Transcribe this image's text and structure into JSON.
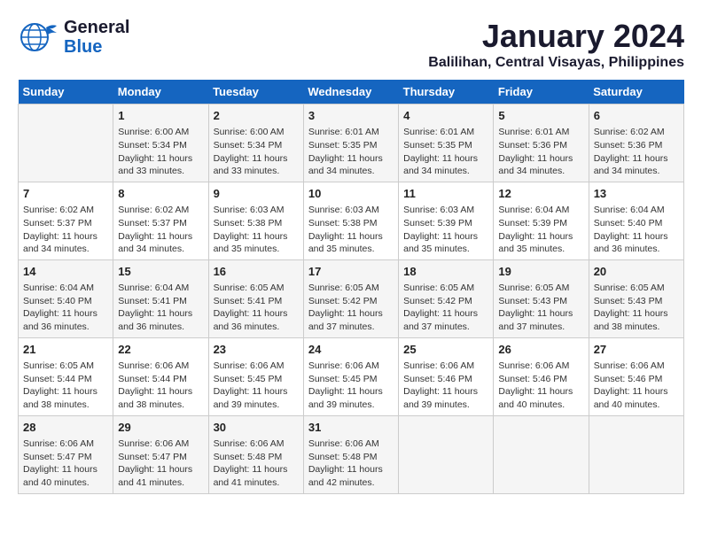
{
  "header": {
    "logo_general": "General",
    "logo_blue": "Blue",
    "month_title": "January 2024",
    "location": "Balilihan, Central Visayas, Philippines"
  },
  "days_of_week": [
    "Sunday",
    "Monday",
    "Tuesday",
    "Wednesday",
    "Thursday",
    "Friday",
    "Saturday"
  ],
  "weeks": [
    [
      {
        "day": "",
        "info": ""
      },
      {
        "day": "1",
        "info": "Sunrise: 6:00 AM\nSunset: 5:34 PM\nDaylight: 11 hours\nand 33 minutes."
      },
      {
        "day": "2",
        "info": "Sunrise: 6:00 AM\nSunset: 5:34 PM\nDaylight: 11 hours\nand 33 minutes."
      },
      {
        "day": "3",
        "info": "Sunrise: 6:01 AM\nSunset: 5:35 PM\nDaylight: 11 hours\nand 34 minutes."
      },
      {
        "day": "4",
        "info": "Sunrise: 6:01 AM\nSunset: 5:35 PM\nDaylight: 11 hours\nand 34 minutes."
      },
      {
        "day": "5",
        "info": "Sunrise: 6:01 AM\nSunset: 5:36 PM\nDaylight: 11 hours\nand 34 minutes."
      },
      {
        "day": "6",
        "info": "Sunrise: 6:02 AM\nSunset: 5:36 PM\nDaylight: 11 hours\nand 34 minutes."
      }
    ],
    [
      {
        "day": "7",
        "info": "Sunrise: 6:02 AM\nSunset: 5:37 PM\nDaylight: 11 hours\nand 34 minutes."
      },
      {
        "day": "8",
        "info": "Sunrise: 6:02 AM\nSunset: 5:37 PM\nDaylight: 11 hours\nand 34 minutes."
      },
      {
        "day": "9",
        "info": "Sunrise: 6:03 AM\nSunset: 5:38 PM\nDaylight: 11 hours\nand 35 minutes."
      },
      {
        "day": "10",
        "info": "Sunrise: 6:03 AM\nSunset: 5:38 PM\nDaylight: 11 hours\nand 35 minutes."
      },
      {
        "day": "11",
        "info": "Sunrise: 6:03 AM\nSunset: 5:39 PM\nDaylight: 11 hours\nand 35 minutes."
      },
      {
        "day": "12",
        "info": "Sunrise: 6:04 AM\nSunset: 5:39 PM\nDaylight: 11 hours\nand 35 minutes."
      },
      {
        "day": "13",
        "info": "Sunrise: 6:04 AM\nSunset: 5:40 PM\nDaylight: 11 hours\nand 36 minutes."
      }
    ],
    [
      {
        "day": "14",
        "info": "Sunrise: 6:04 AM\nSunset: 5:40 PM\nDaylight: 11 hours\nand 36 minutes."
      },
      {
        "day": "15",
        "info": "Sunrise: 6:04 AM\nSunset: 5:41 PM\nDaylight: 11 hours\nand 36 minutes."
      },
      {
        "day": "16",
        "info": "Sunrise: 6:05 AM\nSunset: 5:41 PM\nDaylight: 11 hours\nand 36 minutes."
      },
      {
        "day": "17",
        "info": "Sunrise: 6:05 AM\nSunset: 5:42 PM\nDaylight: 11 hours\nand 37 minutes."
      },
      {
        "day": "18",
        "info": "Sunrise: 6:05 AM\nSunset: 5:42 PM\nDaylight: 11 hours\nand 37 minutes."
      },
      {
        "day": "19",
        "info": "Sunrise: 6:05 AM\nSunset: 5:43 PM\nDaylight: 11 hours\nand 37 minutes."
      },
      {
        "day": "20",
        "info": "Sunrise: 6:05 AM\nSunset: 5:43 PM\nDaylight: 11 hours\nand 38 minutes."
      }
    ],
    [
      {
        "day": "21",
        "info": "Sunrise: 6:05 AM\nSunset: 5:44 PM\nDaylight: 11 hours\nand 38 minutes."
      },
      {
        "day": "22",
        "info": "Sunrise: 6:06 AM\nSunset: 5:44 PM\nDaylight: 11 hours\nand 38 minutes."
      },
      {
        "day": "23",
        "info": "Sunrise: 6:06 AM\nSunset: 5:45 PM\nDaylight: 11 hours\nand 39 minutes."
      },
      {
        "day": "24",
        "info": "Sunrise: 6:06 AM\nSunset: 5:45 PM\nDaylight: 11 hours\nand 39 minutes."
      },
      {
        "day": "25",
        "info": "Sunrise: 6:06 AM\nSunset: 5:46 PM\nDaylight: 11 hours\nand 39 minutes."
      },
      {
        "day": "26",
        "info": "Sunrise: 6:06 AM\nSunset: 5:46 PM\nDaylight: 11 hours\nand 40 minutes."
      },
      {
        "day": "27",
        "info": "Sunrise: 6:06 AM\nSunset: 5:46 PM\nDaylight: 11 hours\nand 40 minutes."
      }
    ],
    [
      {
        "day": "28",
        "info": "Sunrise: 6:06 AM\nSunset: 5:47 PM\nDaylight: 11 hours\nand 40 minutes."
      },
      {
        "day": "29",
        "info": "Sunrise: 6:06 AM\nSunset: 5:47 PM\nDaylight: 11 hours\nand 41 minutes."
      },
      {
        "day": "30",
        "info": "Sunrise: 6:06 AM\nSunset: 5:48 PM\nDaylight: 11 hours\nand 41 minutes."
      },
      {
        "day": "31",
        "info": "Sunrise: 6:06 AM\nSunset: 5:48 PM\nDaylight: 11 hours\nand 42 minutes."
      },
      {
        "day": "",
        "info": ""
      },
      {
        "day": "",
        "info": ""
      },
      {
        "day": "",
        "info": ""
      }
    ]
  ]
}
